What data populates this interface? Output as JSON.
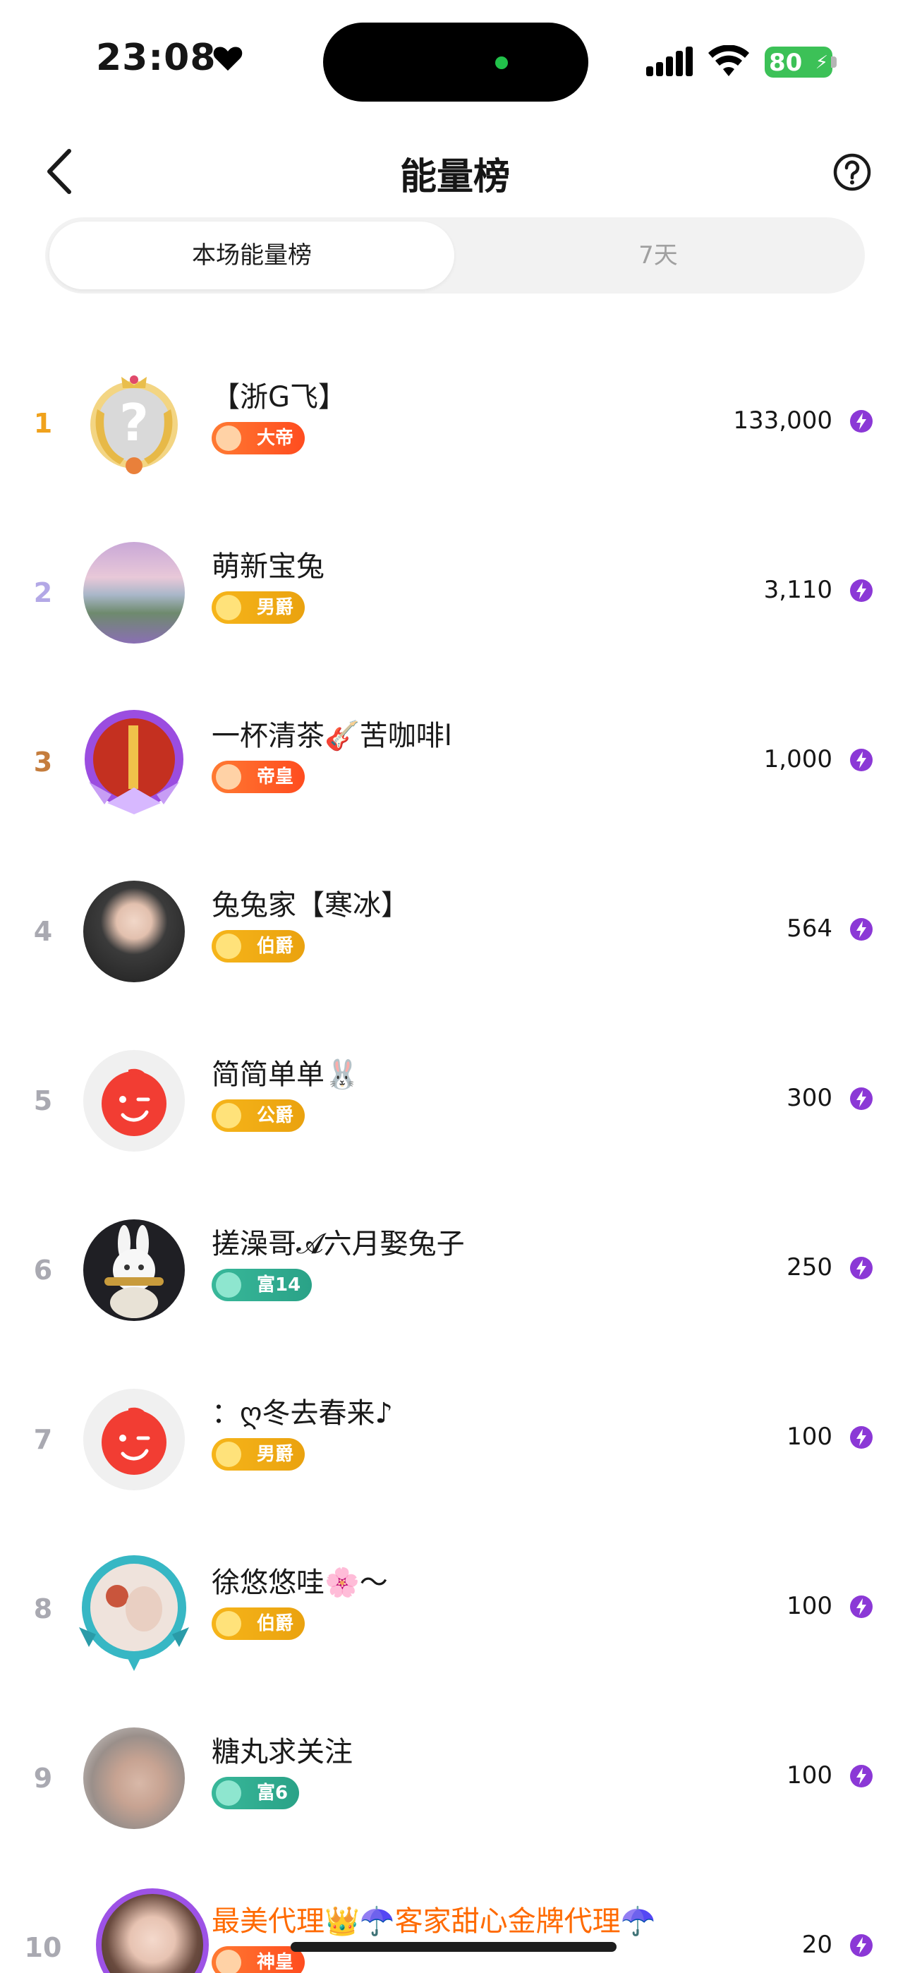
{
  "status_bar": {
    "time": "23:08",
    "battery": "80"
  },
  "header": {
    "title": "能量榜"
  },
  "tabs": [
    {
      "label": "本场能量榜",
      "active": true
    },
    {
      "label": "7天",
      "active": false
    }
  ],
  "colors": {
    "accent": "#8b38d6",
    "rank1": "#f0a21c",
    "rank2": "#b3a8e6",
    "rank3": "#c57d3d",
    "rank_other": "#a9a9b1",
    "highlight_name": "#ff6a00"
  },
  "ranking": [
    {
      "rank": "1",
      "name": "【浙G飞】",
      "badge": "大帝",
      "badge_type": "red",
      "score": "133,000",
      "avatar": "placeholder-question"
    },
    {
      "rank": "2",
      "name": "萌新宝兔",
      "badge": "男爵",
      "badge_type": "gold",
      "score": "3,110",
      "avatar": "landscape"
    },
    {
      "rank": "3",
      "name": "一杯清茶🎸苦咖啡l",
      "badge": "帝皇",
      "badge_type": "red",
      "score": "1,000",
      "avatar": "purple-frame"
    },
    {
      "rank": "4",
      "name": "兔兔家【寒冰】",
      "badge": "伯爵",
      "badge_type": "gold",
      "score": "564",
      "avatar": "photo"
    },
    {
      "rank": "5",
      "name": "简简单单🐰",
      "badge": "公爵",
      "badge_type": "gold",
      "score": "300",
      "avatar": "red-smile"
    },
    {
      "rank": "6",
      "name": "搓澡哥𝓐六月娶兔子",
      "badge": "富14",
      "badge_type": "teal",
      "score": "250",
      "avatar": "rabbit"
    },
    {
      "rank": "7",
      "name": "：ღ冬去春来♪",
      "badge": "男爵",
      "badge_type": "gold",
      "score": "100",
      "avatar": "red-smile"
    },
    {
      "rank": "8",
      "name": "徐悠悠哇🌸～",
      "badge": "伯爵",
      "badge_type": "gold",
      "score": "100",
      "avatar": "teal-frame"
    },
    {
      "rank": "9",
      "name": "糖丸求关注",
      "badge": "富6",
      "badge_type": "teal",
      "score": "100",
      "avatar": "photo-back"
    },
    {
      "rank": "10",
      "name": "最美代理👑☂️客家甜心金牌代理☂️",
      "badge": "神皇",
      "badge_type": "red",
      "score": "20",
      "avatar": "purple-frame-girl"
    }
  ]
}
